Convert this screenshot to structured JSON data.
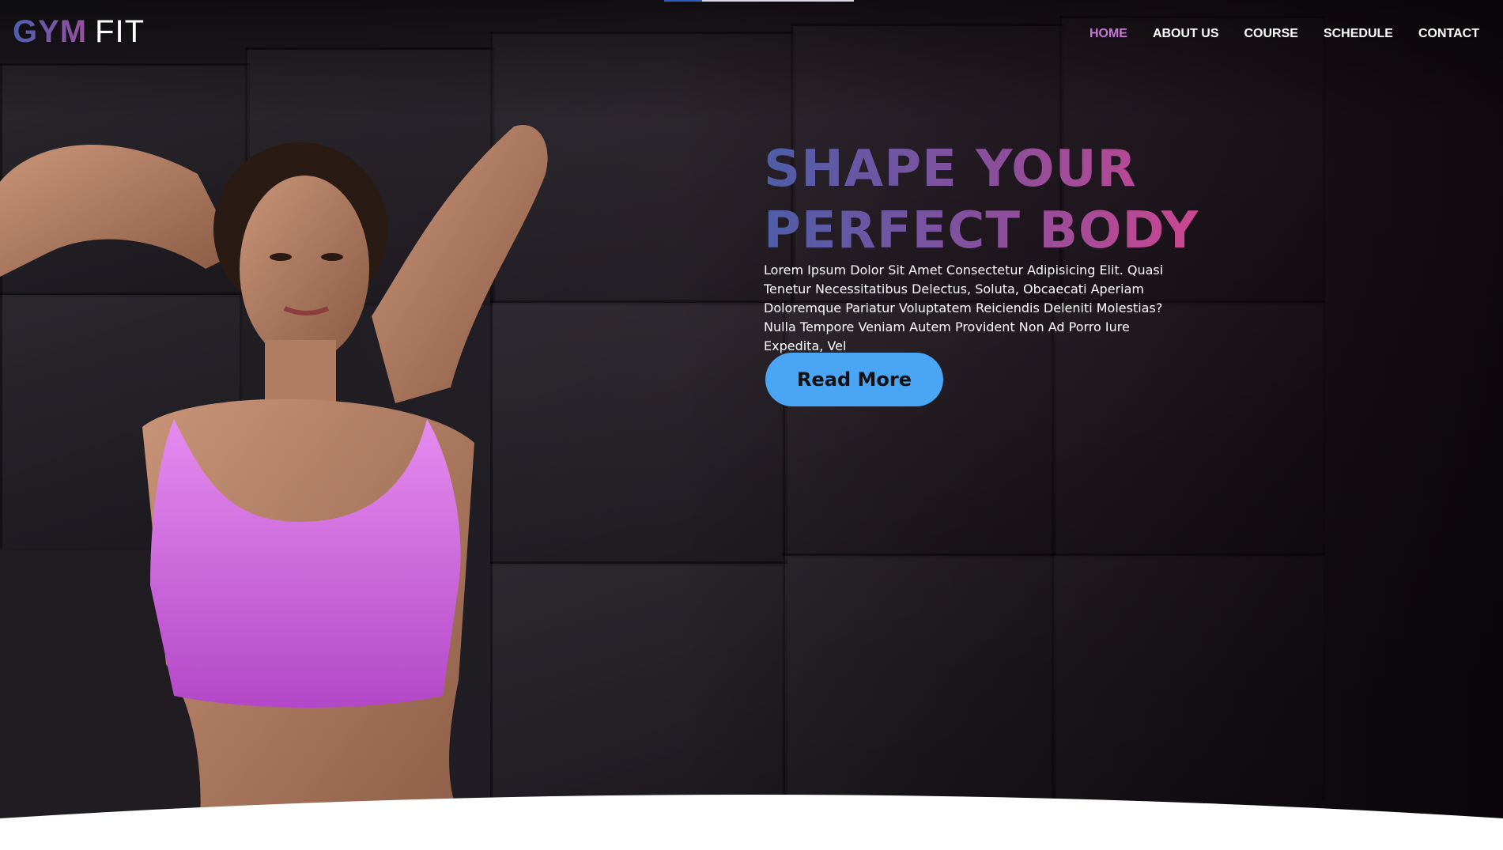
{
  "brand": {
    "part1": "GYM",
    "part2": "FIT"
  },
  "nav": {
    "items": [
      {
        "label": "HOME",
        "active": true
      },
      {
        "label": "ABOUT US",
        "active": false
      },
      {
        "label": "COURSE",
        "active": false
      },
      {
        "label": "SCHEDULE",
        "active": false
      },
      {
        "label": "CONTACT",
        "active": false
      }
    ]
  },
  "hero": {
    "headline_line1": "SHAPE YOUR",
    "headline_line2": "PERFECT BODY",
    "description": "Lorem Ipsum Dolor Sit Amet Consectetur Adipisicing Elit. Quasi Tenetur Necessitatibus Delectus, Soluta, Obcaecati Aperiam Doloremque Pariatur Voluptatem Reiciendis Deleniti Molestias? Nulla Tempore Veniam Autem Provident Non Ad Porro Iure Expedita, Vel",
    "cta_label": "Read More"
  },
  "colors": {
    "accent_active": "#c678d6",
    "button": "#4aa6f5",
    "gradient_start": "#4e5ea8",
    "gradient_end": "#d8458e",
    "top_wear": "#d86fe0"
  }
}
